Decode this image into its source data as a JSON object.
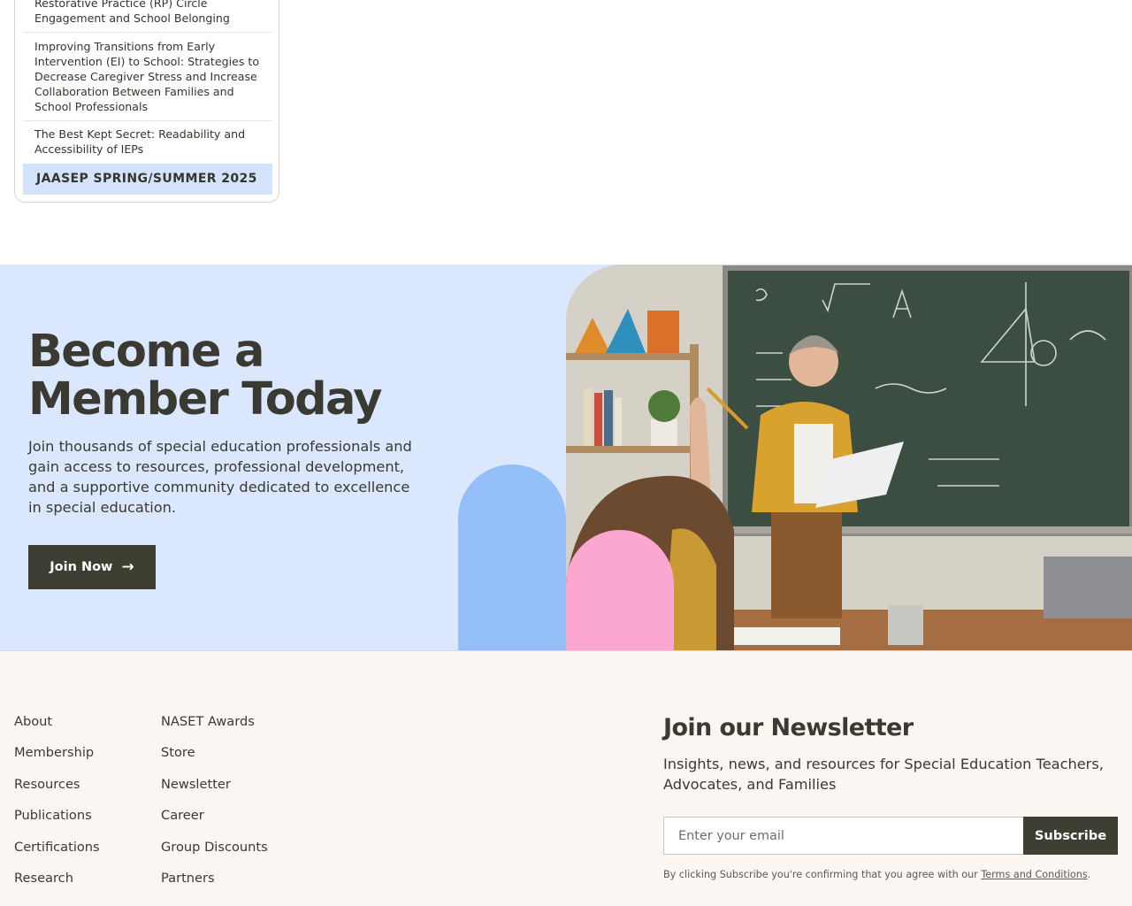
{
  "sidebar": {
    "items": [
      {
        "label": "Restorative Practice (RP) Circle Engagement and School Belonging"
      },
      {
        "label": "Improving Transitions from Early Intervention (EI) to School: Strategies to Decrease Caregiver Stress and Increase Collaboration Between Families and School Professionals"
      },
      {
        "label": "The Best Kept Secret: Readability and Accessibility of IEPs"
      }
    ],
    "active_item": "JAASEP SPRING/SUMMER 2025"
  },
  "membership": {
    "title": "Become a Member Today",
    "description": "Join thousands of special education professionals and gain access to resources, professional development, and a supportive community dedicated to excellence in special education.",
    "button_label": "Join Now",
    "button_icon": "arrow-right-icon",
    "shape_colors": {
      "blue": "#94bff9",
      "pink": "#fba7cf",
      "background": "#dbe7fd"
    }
  },
  "footer": {
    "links_col1": [
      "About",
      "Membership",
      "Resources",
      "Publications",
      "Certifications",
      "Research"
    ],
    "links_col2": [
      "NASET Awards",
      "Store",
      "Newsletter",
      "Career",
      "Group Discounts",
      "Partners"
    ],
    "newsletter": {
      "title": "Join our Newsletter",
      "description": "Insights, news, and resources for Special Education Teachers, Advocates, and Families",
      "email_placeholder": "Enter your email",
      "subscribe_label": "Subscribe",
      "legal_prefix": "By clicking Subscribe you're confirming that you agree with our ",
      "legal_link": "Terms and Conditions",
      "legal_suffix": "."
    }
  }
}
